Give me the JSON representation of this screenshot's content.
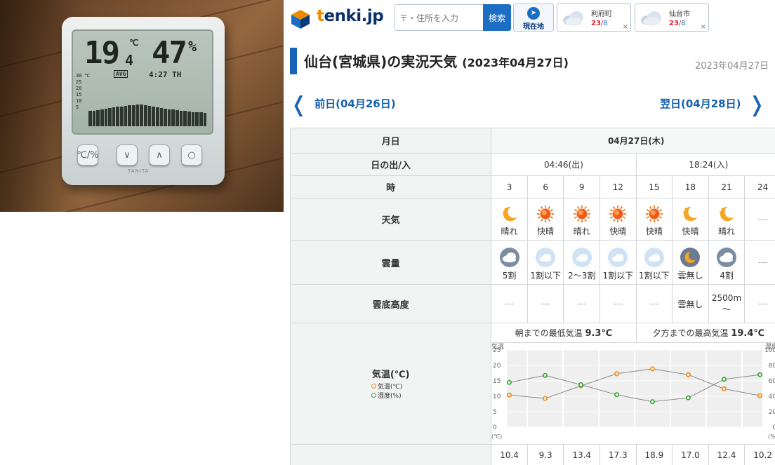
{
  "photo": {
    "lcd_temp": "19",
    "lcd_temp_decimal": "4",
    "lcd_temp_unit": "℃",
    "lcd_humidity": "47",
    "lcd_humidity_unit": "%",
    "lcd_badge": "AVG",
    "lcd_time": "4:27 TH",
    "lcd_scale": [
      "30 ℃",
      "25",
      "20",
      "15",
      "10",
      "5"
    ],
    "buttons": [
      "℃/%",
      "∨",
      "∧",
      "○"
    ],
    "brand": "TANITA"
  },
  "header": {
    "logo_text_k": "t",
    "logo_text_rest": "enki.jp",
    "search_placeholder": "〒・住所を入力",
    "search_label": "検索",
    "geo_label": "現在地",
    "places": [
      {
        "name": "利府町",
        "hi": "23",
        "lo": "8"
      },
      {
        "name": "仙台市",
        "hi": "23",
        "lo": "8"
      }
    ],
    "close": "×"
  },
  "title": {
    "main": "仙台(宮城県)の実況天気",
    "paren": "(2023年04月27日)",
    "date": "2023年04月27日"
  },
  "nav": {
    "prev": "前日(04月26日)",
    "next": "翌日(04月28日)"
  },
  "table": {
    "label_date": "月日",
    "date": "04月27日(木)",
    "label_sun": "日の出/入",
    "sunrise": "04:46(出)",
    "sunset": "18:24(入)",
    "label_hour": "時",
    "hours": [
      "3",
      "6",
      "9",
      "12",
      "15",
      "18",
      "21",
      "24"
    ],
    "label_weather": "天気",
    "weather": [
      "晴れ",
      "快晴",
      "晴れ",
      "快晴",
      "快晴",
      "快晴",
      "晴れ",
      "---"
    ],
    "weather_icons": [
      "moon-icon",
      "sun-icon",
      "sun-icon",
      "sun-icon",
      "sun-icon",
      "moon-icon",
      "moon-icon",
      ""
    ],
    "label_cloud": "雲量",
    "cloud": [
      "5割",
      "1割以下",
      "2〜3割",
      "1割以下",
      "1割以下",
      "雲無し",
      "4割",
      "---"
    ],
    "cloud_icons": [
      "cloud-gray-icon",
      "cloud-light-icon",
      "cloud-light-icon",
      "cloud-light-icon",
      "cloud-light-icon",
      "moon-clear-icon",
      "cloud-gray-icon",
      ""
    ],
    "label_ceiling": "雲底高度",
    "ceiling": [
      "---",
      "---",
      "---",
      "---",
      "---",
      "雲無し",
      "2500m\n〜",
      "---"
    ],
    "label_temp": "気温(℃)",
    "legend_temp": "気温(℃)",
    "legend_hum": "湿度(%)",
    "min_label": "朝までの最低気温",
    "min_value": "9.3℃",
    "max_label": "夕方までの最高気温",
    "max_value": "19.4℃",
    "temps": [
      "10.4",
      "9.3",
      "13.4",
      "17.3",
      "18.9",
      "17.0",
      "12.4",
      "10.2"
    ]
  },
  "chart_data": {
    "type": "line",
    "x": [
      "3",
      "6",
      "9",
      "12",
      "15",
      "18",
      "21",
      "24"
    ],
    "series": [
      {
        "name": "気温(℃)",
        "values": [
          10.4,
          9.3,
          13.4,
          17.3,
          18.9,
          17.0,
          12.4,
          10.2
        ],
        "color": "#f08a1c"
      },
      {
        "name": "湿度(%)",
        "values": [
          58,
          67,
          55,
          42,
          33,
          38,
          62,
          68
        ],
        "color": "#3aa83a"
      }
    ],
    "ylabel_left": "気温",
    "ylabel_right": "湿度",
    "yunit_left": "(℃)",
    "yunit_right": "(%)",
    "ylim_left": [
      0,
      25
    ],
    "ylim_right": [
      0,
      100
    ],
    "yticks_left": [
      "25",
      "20",
      "15",
      "10",
      "5",
      "0"
    ],
    "yticks_right": [
      "100",
      "80",
      "60",
      "40",
      "20",
      "0"
    ],
    "grid": true
  }
}
